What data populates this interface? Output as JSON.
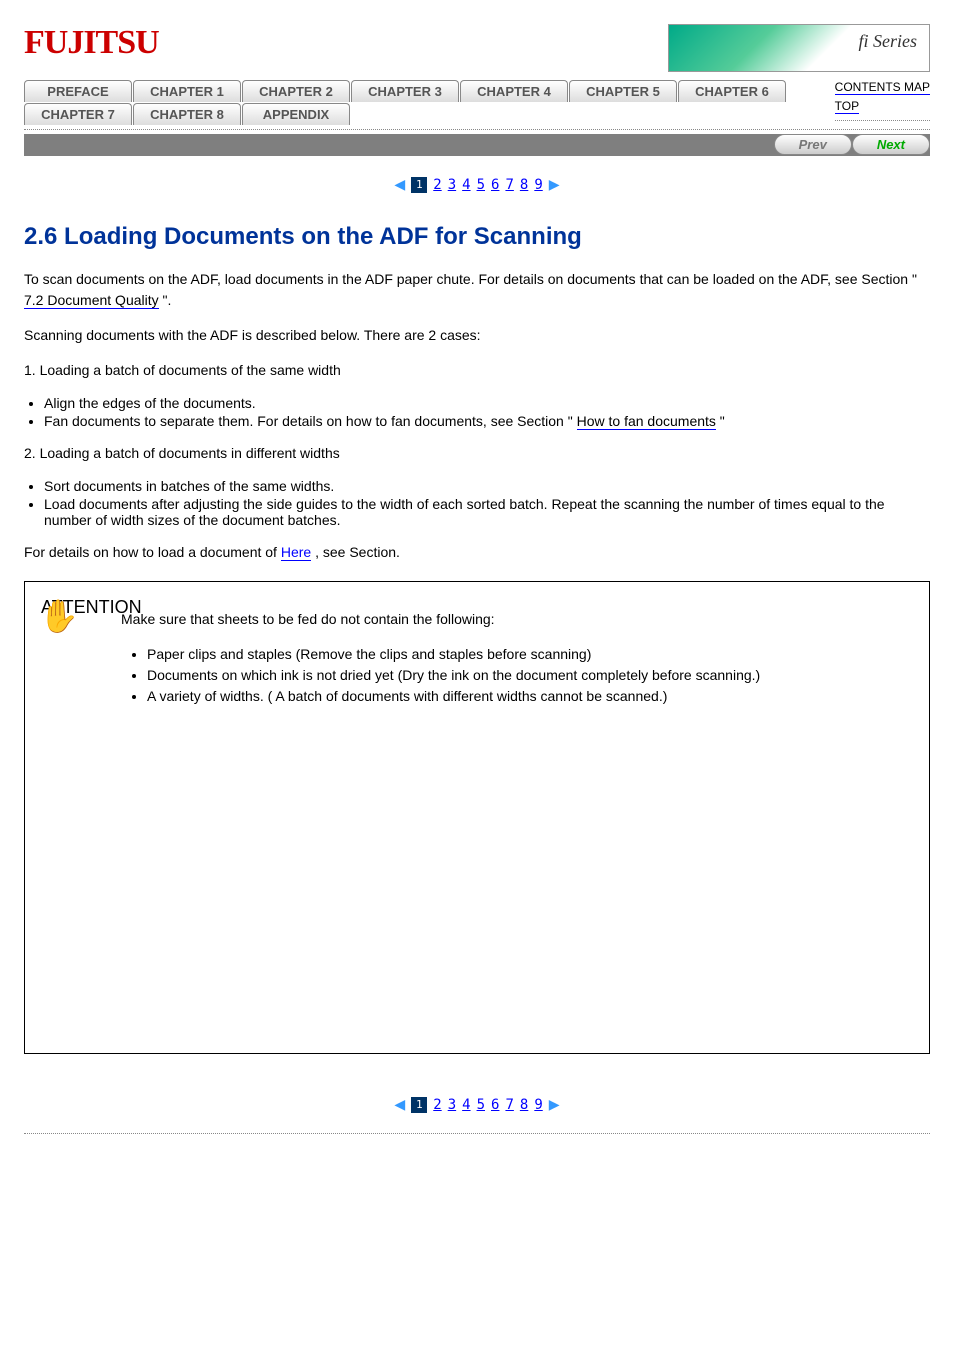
{
  "header": {
    "logo": "FUJITSU",
    "banner": "fi Series"
  },
  "tabs": [
    "PREFACE",
    "CHAPTER 1",
    "CHAPTER 2",
    "CHAPTER 3",
    "CHAPTER 4",
    "CHAPTER 5",
    "CHAPTER 6",
    "CHAPTER 7",
    "CHAPTER 8",
    "APPENDIX"
  ],
  "rightlinks": {
    "contents": "CONTENTS MAP",
    "top": "TOP"
  },
  "bar": {
    "title": "",
    "prev": "Prev",
    "next": "Next"
  },
  "pager": {
    "current": "1",
    "pages": [
      "2",
      "3",
      "4",
      "5",
      "6",
      "7",
      "8",
      "9"
    ]
  },
  "title": "2.6 Loading Documents on the ADF for Scanning",
  "p1a": "To scan documents on the ADF, load documents in the ADF paper chute. For details on documents that can be loaded on the ADF, see Section \"",
  "p1link": "7.2 Document Quality",
  "p1b": "\".",
  "p2": "Scanning documents with the ADF is described below. There are 2 cases:",
  "case1a": "Align the edges of the documents.",
  "case1b": "Fan documents to separate them. For details on how to fan documents, see Section \"",
  "case1link": "How to fan documents",
  "case1c": "\"",
  "p3": "2. Loading a batch of documents in different widths",
  "case2a": "Sort documents in batches of the same widths.",
  "case2b": "Load documents after adjusting the side guides to the width of each sorted batch. Repeat the scanning the number of times equal to the number of width sizes of the document batches.",
  "note1": "For details on how to load a document of ",
  "note1link": "Here",
  "note1b": ", see Section.",
  "attn": {
    "label": "ATTENTION",
    "intro": "Make sure that sheets to be fed do not contain the following:",
    "b1": "Paper clips and staples (Remove the clips and staples before scanning)",
    "b2": "Documents on which ink is not dried yet (Dry the ink on the document completely before scanning.)",
    "b3": "A variety of widths. ( A batch of documents with different widths cannot be scanned.)"
  }
}
